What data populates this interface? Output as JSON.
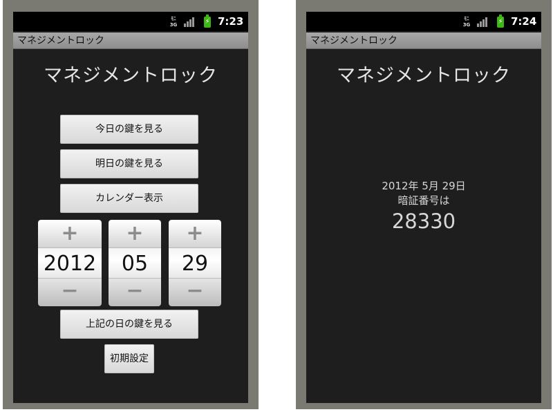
{
  "screens": [
    {
      "status": {
        "network": [
          "ﾓﾆ",
          "3G"
        ],
        "time": "7:23"
      },
      "app_title": "マネジメントロック",
      "heading": "マネジメントロック",
      "buttons": {
        "today_key": "今日の鍵を見る",
        "tomorrow_key": "明日の鍵を見る",
        "calendar": "カレンダー表示",
        "view_date_key": "上記の日の鍵を見る",
        "initial_settings": "初期設定"
      },
      "pickers": {
        "plus": "+",
        "minus": "−",
        "year": "2012",
        "month": "05",
        "day": "29"
      }
    },
    {
      "status": {
        "network": [
          "ﾓﾆ",
          "3G"
        ],
        "time": "7:24"
      },
      "app_title": "マネジメントロック",
      "heading": "マネジメントロック",
      "result": {
        "date": "2012年 5月 29日",
        "label": "暗証番号は",
        "code": "28330"
      }
    }
  ],
  "colors": {
    "screen_bg": "#1e1e1e",
    "status_bar": "#000000",
    "title_bar": "#9a9a9a",
    "battery": "#3fb618",
    "phone_frame": "#7a7a72"
  },
  "icons": [
    "3g-network-icon",
    "signal-icon",
    "battery-charging-icon"
  ]
}
